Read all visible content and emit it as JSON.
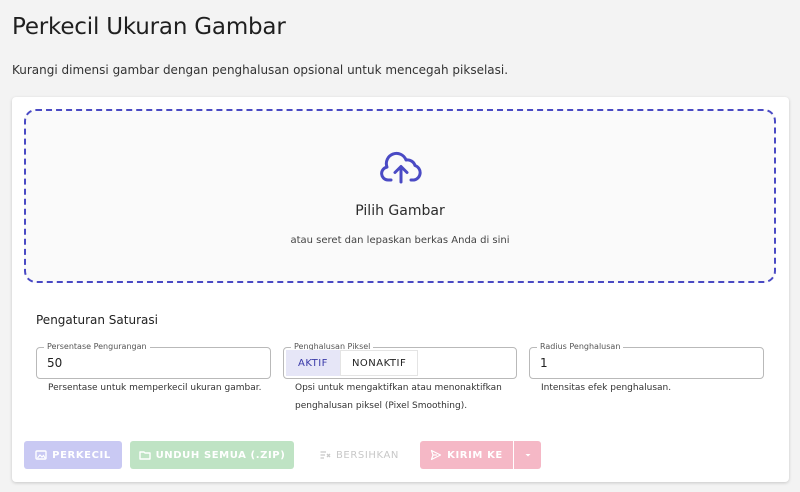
{
  "header": {
    "title": "Perkecil Ukuran Gambar",
    "description": "Kurangi dimensi gambar dengan penghalusan opsional untuk mencegah pikselasi."
  },
  "dropzone": {
    "icon": "cloud-upload-icon",
    "title": "Pilih Gambar",
    "hint": "atau seret dan lepaskan berkas Anda di sini"
  },
  "settings": {
    "title": "Pengaturan Saturasi",
    "reduction": {
      "label": "Persentase Pengurangan",
      "value": "50",
      "helper": "Persentase untuk memperkecil ukuran gambar."
    },
    "smoothing": {
      "label": "Penghalusan Piksel",
      "options": [
        "AKTIF",
        "NONAKTIF"
      ],
      "selected": "AKTIF",
      "helper_line1": "Opsi untuk mengaktifkan atau menonaktifkan",
      "helper_line2": "penghalusan piksel (Pixel Smoothing)."
    },
    "radius": {
      "label": "Radius Penghalusan",
      "value": "1",
      "helper": "Intensitas efek penghalusan."
    }
  },
  "actions": {
    "shrink": "PERKECIL",
    "download_all": "UNDUH SEMUA (.ZIP)",
    "clear": "BERSIHKAN",
    "send_to": "KIRIM KE"
  },
  "colors": {
    "accent": "#4a4ac4",
    "shrink_disabled": "#c9c9f3",
    "download_disabled": "#bfe3c4",
    "send_disabled": "#f5b8c6",
    "clear_disabled_text": "#c8c8c8"
  }
}
